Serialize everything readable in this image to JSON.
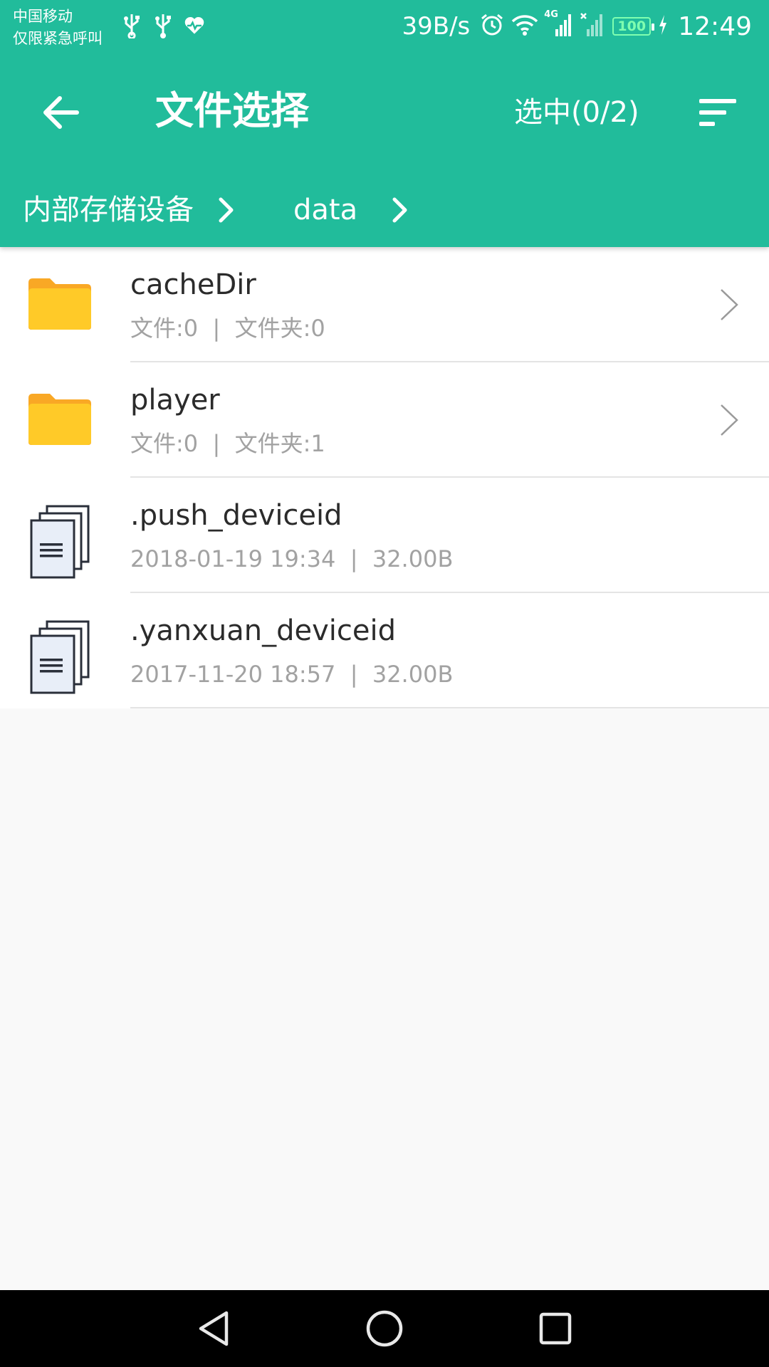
{
  "status_bar": {
    "carrier_line1": "中国移动",
    "carrier_line2": "仅限紧急呼叫",
    "net_speed": "39B/s",
    "network_type": "4G",
    "battery": "100",
    "time": "12:49",
    "icons": [
      "usb-icon",
      "usb-icon",
      "health-icon",
      "alarm-icon",
      "wifi-icon",
      "signal-icon",
      "no-signal-icon",
      "battery-icon",
      "charging-icon"
    ]
  },
  "toolbar": {
    "title": "文件选择",
    "select_count": "选中(0/2)",
    "icons": [
      "back-arrow-icon",
      "sort-icon"
    ]
  },
  "breadcrumb": {
    "items": [
      {
        "label": "内部存储设备"
      },
      {
        "label": "data"
      }
    ]
  },
  "files": [
    {
      "name": "cacheDir",
      "meta": "文件:0  |  文件夹:0",
      "type": "folder"
    },
    {
      "name": "player",
      "meta": "文件:0  |  文件夹:1",
      "type": "folder"
    },
    {
      "name": ".push_deviceid",
      "meta": "2018-01-19 19:34  |  32.00B",
      "type": "file"
    },
    {
      "name": ".yanxuan_deviceid",
      "meta": "2017-11-20 18:57  |  32.00B",
      "type": "file"
    }
  ],
  "nav_bar": {
    "icons": [
      "nav-back-icon",
      "nav-home-icon",
      "nav-recent-icon"
    ]
  },
  "colors": {
    "accent": "#21bc9b",
    "folder": "#ffca28",
    "folder_tab": "#f9a825",
    "background": "#f9f9f9"
  }
}
